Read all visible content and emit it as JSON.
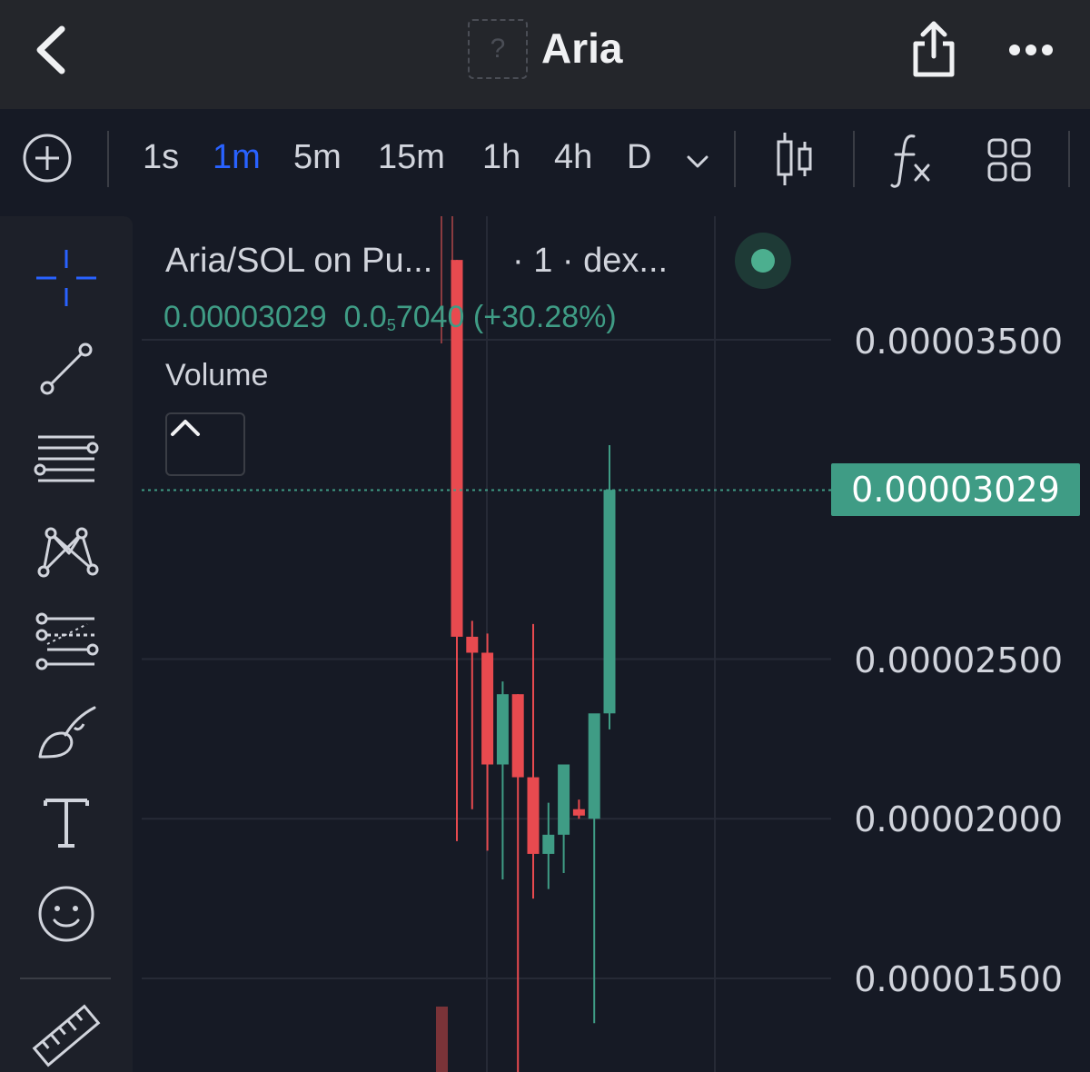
{
  "header": {
    "title": "Aria",
    "logo_placeholder": "?",
    "icons": {
      "back": "chevron-left-icon",
      "share": "share-icon",
      "more": "more-horizontal-icon"
    }
  },
  "toolbar": {
    "intervals": [
      "1s",
      "1m",
      "5m",
      "15m",
      "1h",
      "4h",
      "D"
    ],
    "active_interval": "1m",
    "icons": [
      "add-circle-icon",
      "chevron-down-icon",
      "candlestick-icon",
      "fx-icon",
      "layout-grid-icon"
    ]
  },
  "drawing_tools": [
    "crosshair-icon",
    "trend-line-icon",
    "horizontal-lines-icon",
    "pattern-icon",
    "fib-icon",
    "brush-icon",
    "text-icon",
    "emoji-icon",
    "ruler-icon"
  ],
  "legend": {
    "symbol": "Aria/SOL on Pu...",
    "meta": "· 1 · dex...",
    "price": "0.00003029",
    "change_prefix": "0.0",
    "change_sub": "5",
    "change_suffix": "7040",
    "change_pct": "(+30.28%)",
    "volume_label": "Volume"
  },
  "colors": {
    "up": "#3f9c85",
    "down": "#e84a4f",
    "accent": "#2962ff",
    "background": "#161a25"
  },
  "chart_data": {
    "type": "candlestick",
    "price_axis": [
      "0.00003500",
      "0.00002500",
      "0.00002000",
      "0.00001500"
    ],
    "current_price": "0.00003029",
    "candles": [
      {
        "open": 3.75e-05,
        "high": 3.75e-05,
        "low": 1.93e-05,
        "close": 2.57e-05
      },
      {
        "open": 2.57e-05,
        "high": 2.62e-05,
        "low": 2.03e-05,
        "close": 2.52e-05
      },
      {
        "open": 2.52e-05,
        "high": 2.58e-05,
        "low": 1.9e-05,
        "close": 2.17e-05
      },
      {
        "open": 2.17e-05,
        "high": 2.43e-05,
        "low": 1.81e-05,
        "close": 2.39e-05
      },
      {
        "open": 2.39e-05,
        "high": 2.39e-05,
        "low": 1.2e-05,
        "close": 2.13e-05
      },
      {
        "open": 2.13e-05,
        "high": 2.61e-05,
        "low": 1.75e-05,
        "close": 1.89e-05
      },
      {
        "open": 1.89e-05,
        "high": 2.05e-05,
        "low": 1.78e-05,
        "close": 1.95e-05
      },
      {
        "open": 1.95e-05,
        "high": 2.11e-05,
        "low": 1.83e-05,
        "close": 2.17e-05
      },
      {
        "open": 2.03e-05,
        "high": 2.06e-05,
        "low": 2e-05,
        "close": 2.01e-05
      },
      {
        "open": 2e-05,
        "high": 2.17e-05,
        "low": 1.36e-05,
        "close": 2.33e-05
      },
      {
        "open": 2.33e-05,
        "high": 3.17e-05,
        "low": 2.28e-05,
        "close": 3.03e-05
      }
    ],
    "volume_bars": [
      0.9
    ]
  }
}
